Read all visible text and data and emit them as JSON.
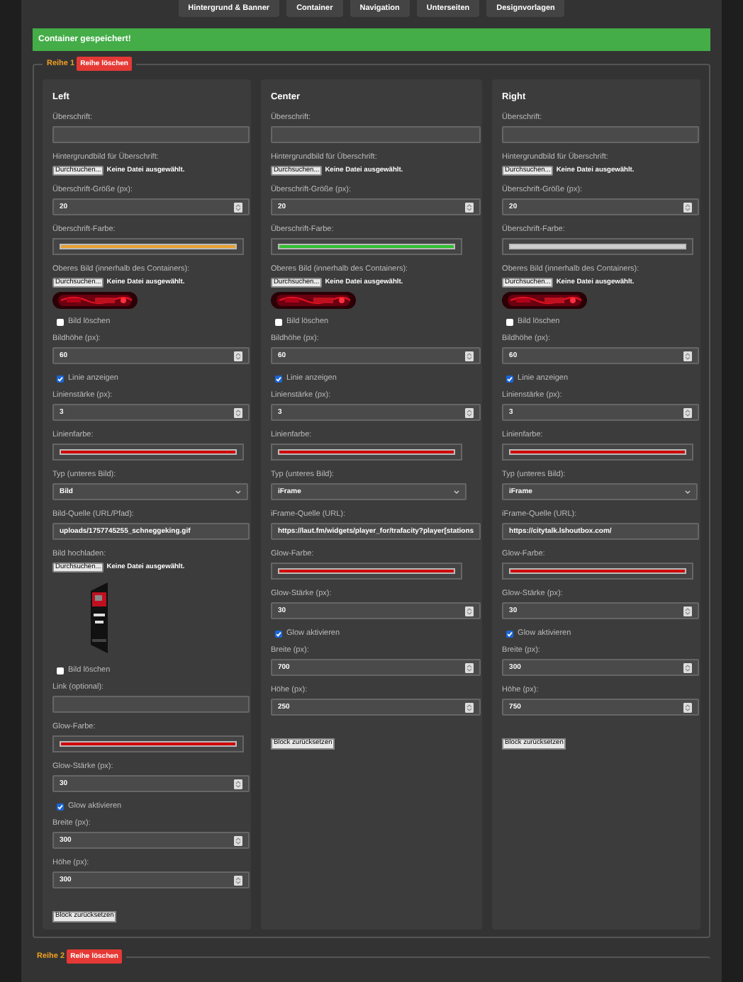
{
  "nav": [
    {
      "label": "Hintergrund & Banner"
    },
    {
      "label": "Container"
    },
    {
      "label": "Navigation"
    },
    {
      "label": "Unterseiten"
    },
    {
      "label": "Designvorlagen"
    }
  ],
  "notice": "Container gespeichert!",
  "rows": [
    {
      "legend": "Reihe 1",
      "delete_label": "Reihe löschen",
      "columns": [
        {
          "title": "Left",
          "fields": [
            {
              "kind": "text",
              "label": "Überschrift:"
            },
            {
              "kind": "file",
              "label": "Hintergrundbild für Überschrift:",
              "button": "Durchsuchen...",
              "status": "Keine Datei ausgewählt."
            },
            {
              "kind": "number",
              "label": "Überschrift-Größe (px):",
              "value": "20"
            },
            {
              "kind": "color",
              "label": "Überschrift-Farbe:",
              "color": "#e8a030"
            },
            {
              "kind": "file",
              "label": "Oberes Bild (innerhalb des Containers):",
              "button": "Durchsuchen...",
              "status": "Keine Datei ausgewählt."
            },
            {
              "kind": "banner"
            },
            {
              "kind": "checkbox",
              "label": "Bild löschen",
              "checked": false
            },
            {
              "kind": "number",
              "label": "Bildhöhe (px):",
              "value": "60"
            },
            {
              "kind": "checkbox",
              "label": "Linie anzeigen",
              "checked": true
            },
            {
              "kind": "number",
              "label": "Linienstärke (px):",
              "value": "3"
            },
            {
              "kind": "color",
              "label": "Linienfarbe:",
              "color": "#d00000"
            },
            {
              "kind": "select",
              "label": "Typ (unteres Bild):",
              "value": "Bild"
            },
            {
              "kind": "text",
              "label": "Bild-Quelle (URL/Pfad):",
              "value": "uploads/1757745255_schneggeking.gif"
            },
            {
              "kind": "file",
              "label": "Bild hochladen:",
              "button": "Durchsuchen...",
              "status": "Keine Datei ausgewählt."
            },
            {
              "kind": "tall_image"
            },
            {
              "kind": "checkbox",
              "label": "Bild löschen",
              "checked": false
            },
            {
              "kind": "text",
              "label": "Link (optional):"
            },
            {
              "kind": "color",
              "label": "Glow-Farbe:",
              "color": "#d00000"
            },
            {
              "kind": "number",
              "label": "Glow-Stärke (px):",
              "value": "30"
            },
            {
              "kind": "checkbox",
              "label": "Glow aktivieren",
              "checked": true
            },
            {
              "kind": "number",
              "label": "Breite (px):",
              "value": "300"
            },
            {
              "kind": "number",
              "label": "Höhe (px):",
              "value": "300"
            },
            {
              "kind": "button",
              "label": "Block zurücksetzen"
            }
          ]
        },
        {
          "title": "Center",
          "fields": [
            {
              "kind": "text",
              "label": "Überschrift:"
            },
            {
              "kind": "file",
              "label": "Hintergrundbild für Überschrift:",
              "button": "Durchsuchen...",
              "status": "Keine Datei ausgewählt."
            },
            {
              "kind": "number",
              "label": "Überschrift-Größe (px):",
              "value": "20"
            },
            {
              "kind": "color",
              "label": "Überschrift-Farbe:",
              "color": "#30c030"
            },
            {
              "kind": "file",
              "label": "Oberes Bild (innerhalb des Containers):",
              "button": "Durchsuchen...",
              "status": "Keine Datei ausgewählt."
            },
            {
              "kind": "banner"
            },
            {
              "kind": "checkbox",
              "label": "Bild löschen",
              "checked": false
            },
            {
              "kind": "number",
              "label": "Bildhöhe (px):",
              "value": "60"
            },
            {
              "kind": "checkbox",
              "label": "Linie anzeigen",
              "checked": true
            },
            {
              "kind": "number",
              "label": "Linienstärke (px):",
              "value": "3"
            },
            {
              "kind": "color",
              "label": "Linienfarbe:",
              "color": "#d00000"
            },
            {
              "kind": "select",
              "label": "Typ (unteres Bild):",
              "value": "iFrame"
            },
            {
              "kind": "text",
              "label": "iFrame-Quelle (URL):",
              "value": "https://laut.fm/widgets/player_for/trafacity?player[stations"
            },
            {
              "kind": "color",
              "label": "Glow-Farbe:",
              "color": "#d00000"
            },
            {
              "kind": "number",
              "label": "Glow-Stärke (px):",
              "value": "30"
            },
            {
              "kind": "checkbox",
              "label": "Glow aktivieren",
              "checked": true
            },
            {
              "kind": "number",
              "label": "Breite (px):",
              "value": "700"
            },
            {
              "kind": "number",
              "label": "Höhe (px):",
              "value": "250"
            },
            {
              "kind": "button",
              "label": "Block zurücksetzen"
            }
          ]
        },
        {
          "title": "Right",
          "fields": [
            {
              "kind": "text",
              "label": "Überschrift:"
            },
            {
              "kind": "file",
              "label": "Hintergrundbild für Überschrift:",
              "button": "Durchsuchen...",
              "status": "Keine Datei ausgewählt."
            },
            {
              "kind": "number",
              "label": "Überschrift-Größe (px):",
              "value": "20"
            },
            {
              "kind": "color",
              "label": "Überschrift-Farbe:",
              "color": "#d0d0d0"
            },
            {
              "kind": "file",
              "label": "Oberes Bild (innerhalb des Containers):",
              "button": "Durchsuchen...",
              "status": "Keine Datei ausgewählt."
            },
            {
              "kind": "banner"
            },
            {
              "kind": "checkbox",
              "label": "Bild löschen",
              "checked": false
            },
            {
              "kind": "number",
              "label": "Bildhöhe (px):",
              "value": "60"
            },
            {
              "kind": "checkbox",
              "label": "Linie anzeigen",
              "checked": true
            },
            {
              "kind": "number",
              "label": "Linienstärke (px):",
              "value": "3"
            },
            {
              "kind": "color",
              "label": "Linienfarbe:",
              "color": "#d00000"
            },
            {
              "kind": "select",
              "label": "Typ (unteres Bild):",
              "value": "iFrame"
            },
            {
              "kind": "text",
              "label": "iFrame-Quelle (URL):",
              "value": "https://citytalk.lshoutbox.com/"
            },
            {
              "kind": "color",
              "label": "Glow-Farbe:",
              "color": "#d00000"
            },
            {
              "kind": "number",
              "label": "Glow-Stärke (px):",
              "value": "30"
            },
            {
              "kind": "checkbox",
              "label": "Glow aktivieren",
              "checked": true
            },
            {
              "kind": "number",
              "label": "Breite (px):",
              "value": "300"
            },
            {
              "kind": "number",
              "label": "Höhe (px):",
              "value": "750"
            },
            {
              "kind": "button",
              "label": "Block zurücksetzen"
            }
          ]
        }
      ]
    },
    {
      "legend": "Reihe 2",
      "delete_label": "Reihe löschen"
    }
  ]
}
